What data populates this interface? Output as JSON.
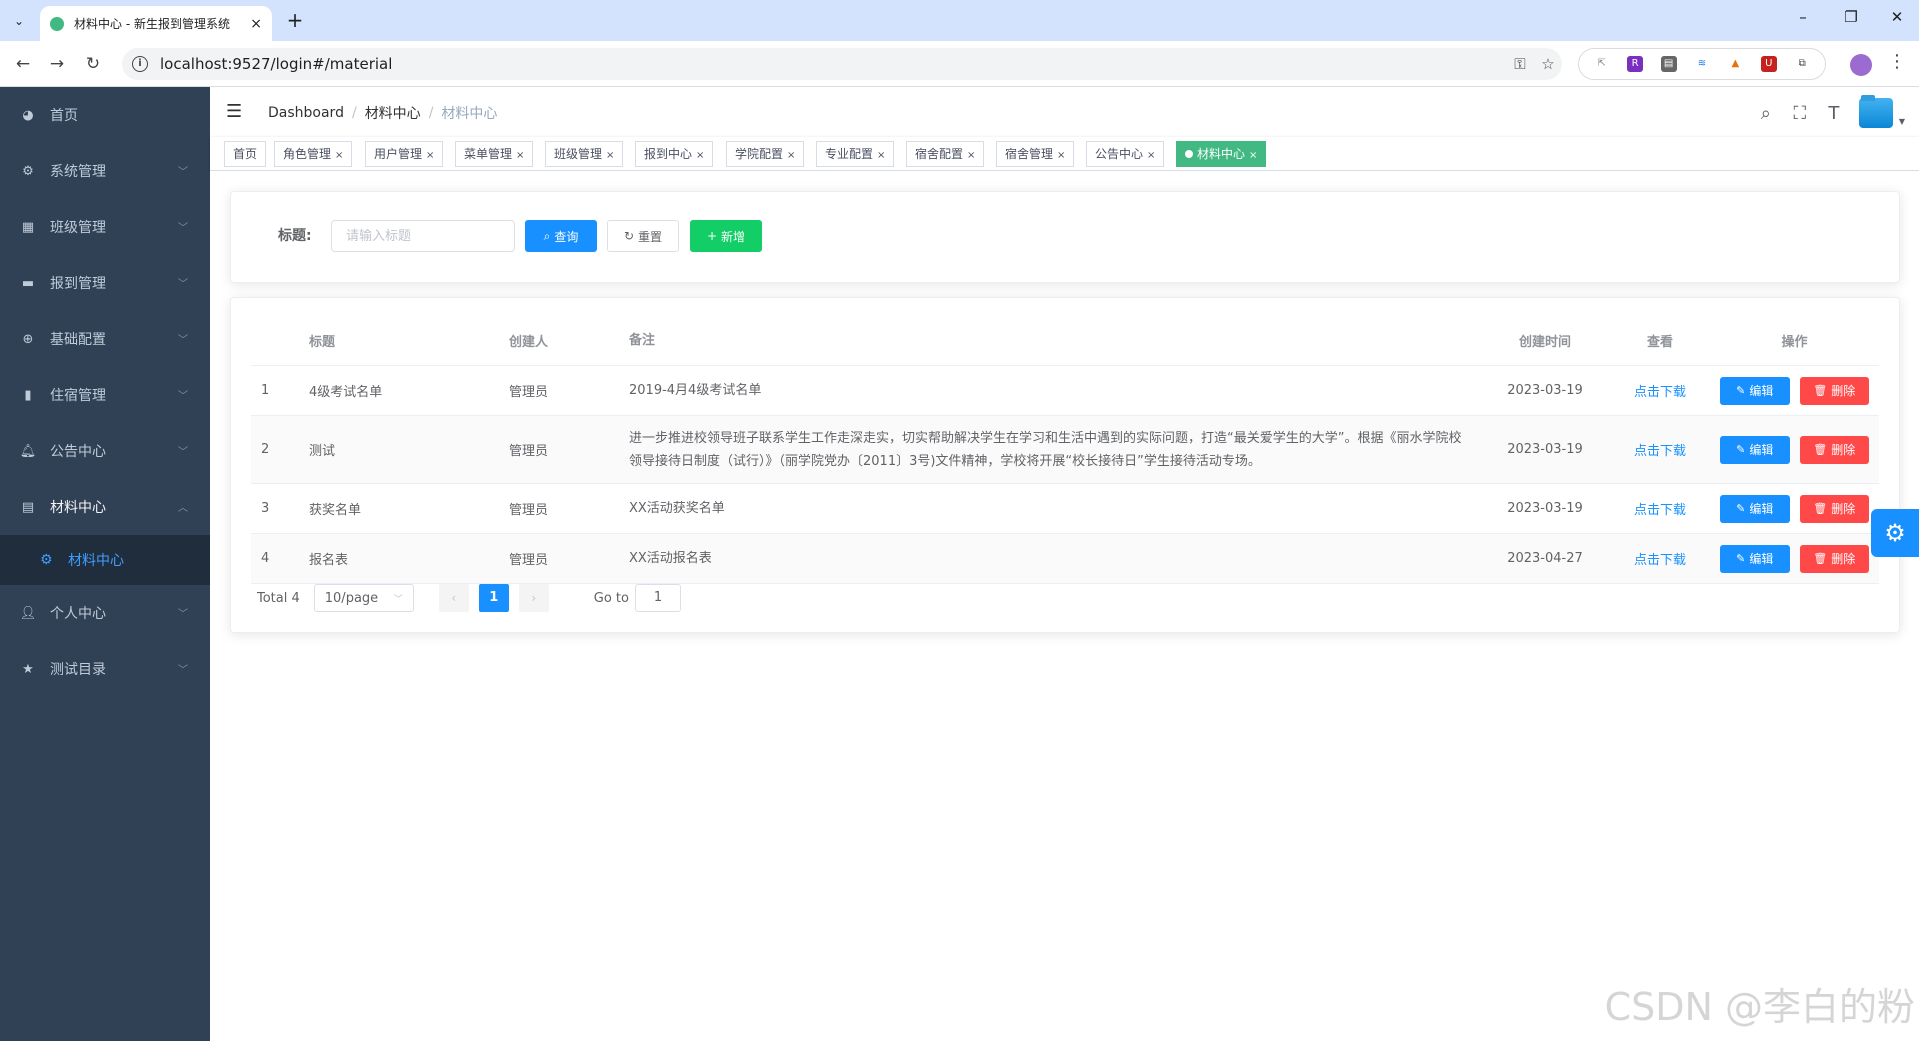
{
  "browser": {
    "tab_title": "材料中心 - 新生报到管理系统",
    "url": "localhost:9527/login#/material"
  },
  "sidebar": {
    "items": [
      {
        "label": "首页",
        "icon": "dashboard-icon"
      },
      {
        "label": "系统管理",
        "icon": "gear-icon"
      },
      {
        "label": "班级管理",
        "icon": "grid-icon"
      },
      {
        "label": "报到管理",
        "icon": "monitor-icon"
      },
      {
        "label": "基础配置",
        "icon": "compass-icon"
      },
      {
        "label": "住宿管理",
        "icon": "bar-chart-icon"
      },
      {
        "label": "公告中心",
        "icon": "bell-icon"
      },
      {
        "label": "材料中心",
        "icon": "clipboard-icon"
      }
    ],
    "sub_active": "材料中心",
    "items_after": [
      {
        "label": "个人中心",
        "icon": "user-icon"
      },
      {
        "label": "测试目录",
        "icon": "star-icon"
      }
    ]
  },
  "breadcrumb": [
    "Dashboard",
    "材料中心",
    "材料中心"
  ],
  "tags": [
    {
      "label": "首页",
      "closable": false
    },
    {
      "label": "角色管理",
      "closable": true
    },
    {
      "label": "用户管理",
      "closable": true
    },
    {
      "label": "菜单管理",
      "closable": true
    },
    {
      "label": "班级管理",
      "closable": true
    },
    {
      "label": "报到中心",
      "closable": true
    },
    {
      "label": "学院配置",
      "closable": true
    },
    {
      "label": "专业配置",
      "closable": true
    },
    {
      "label": "宿舍配置",
      "closable": true
    },
    {
      "label": "宿舍管理",
      "closable": true
    },
    {
      "label": "公告中心",
      "closable": true
    },
    {
      "label": "材料中心",
      "closable": true,
      "active": true
    }
  ],
  "search": {
    "label": "标题:",
    "placeholder": "请输入标题",
    "query_btn": "查询",
    "reset_btn": "重置",
    "add_btn": "新增"
  },
  "table": {
    "headers": {
      "title": "标题",
      "creator": "创建人",
      "note": "备注",
      "time": "创建时间",
      "view": "查看",
      "ops": "操作"
    },
    "rows": [
      {
        "idx": "1",
        "title": "4级考试名单",
        "creator": "管理员",
        "note": "2019-4月4级考试名单",
        "time": "2023-03-19",
        "view": "点击下载"
      },
      {
        "idx": "2",
        "title": "测试",
        "creator": "管理员",
        "note": "进一步推进校领导班子联系学生工作走深走实，切实帮助解决学生在学习和生活中遇到的实际问题，打造“最关爱学生的大学”。根据《丽水学院校领导接待日制度（试行）》（丽学院党办〔2011〕3号)文件精神，学校将开展“校长接待日”学生接待活动专场。",
        "time": "2023-03-19",
        "view": "点击下载"
      },
      {
        "idx": "3",
        "title": "获奖名单",
        "creator": "管理员",
        "note": "XX活动获奖名单",
        "time": "2023-03-19",
        "view": "点击下载"
      },
      {
        "idx": "4",
        "title": "报名表",
        "creator": "管理员",
        "note": "XX活动报名表",
        "time": "2023-04-27",
        "view": "点击下载"
      }
    ],
    "edit_label": "编辑",
    "delete_label": "删除"
  },
  "pagination": {
    "total": "Total 4",
    "page_size": "10/page",
    "current": "1",
    "goto_label": "Go to",
    "goto_value": "1"
  },
  "watermark": "CSDN @李白的粉",
  "colors": {
    "sidebar": "#304156",
    "primary": "#1890ff",
    "success": "#13ce66",
    "danger": "#ff4949",
    "tag_active": "#42b983"
  }
}
